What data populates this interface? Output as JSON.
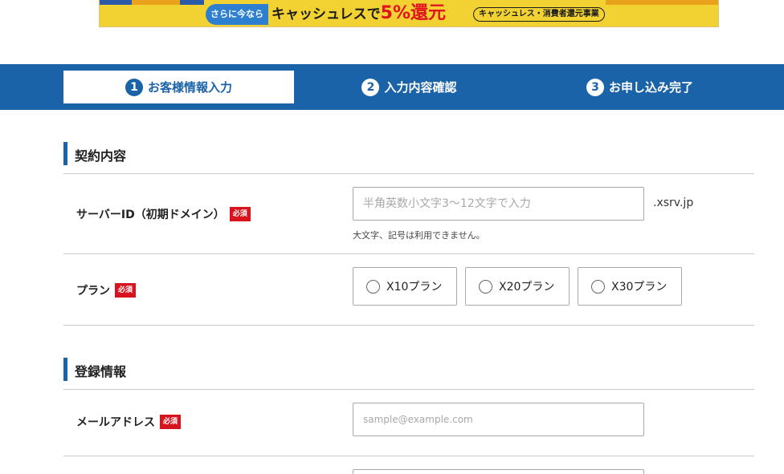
{
  "banner": {
    "tag": "さらに今なら",
    "main_prefix": "キャッシュレスで",
    "main_highlight": "5%還元",
    "badge": "キャッシュレス・消費者還元事業"
  },
  "steps": [
    {
      "num": "1",
      "label": "お客様情報入力"
    },
    {
      "num": "2",
      "label": "入力内容確認"
    },
    {
      "num": "3",
      "label": "お申し込み完了"
    }
  ],
  "required_label": "必須",
  "contract": {
    "title": "契約内容",
    "server_id": {
      "label": "サーバーID（初期ドメイン）",
      "placeholder": "半角英数小文字3～12文字で入力",
      "value": "",
      "suffix": ".xsrv.jp",
      "note": "大文字、記号は利用できません。"
    },
    "plan": {
      "label": "プラン",
      "options": [
        "X10プラン",
        "X20プラン",
        "X30プラン"
      ]
    }
  },
  "registration": {
    "title": "登録情報",
    "email": {
      "label": "メールアドレス",
      "placeholder": "sample@example.com",
      "value": ""
    }
  }
}
